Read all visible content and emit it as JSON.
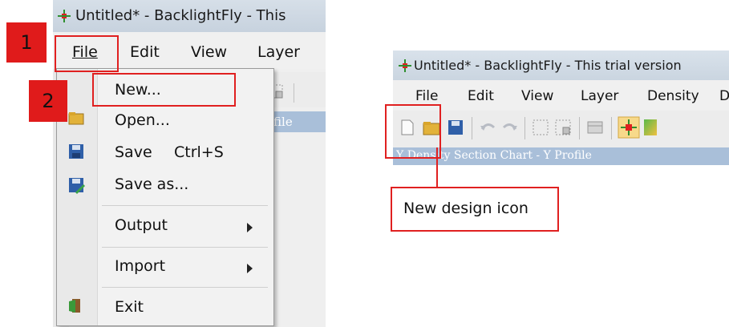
{
  "left": {
    "window_title": "Untitled* - BacklightFly - This",
    "menu": [
      "File",
      "Edit",
      "View",
      "Layer"
    ],
    "profile_text": "ofile",
    "dropdown": [
      {
        "label": "New...",
        "shortcut": "",
        "submenu": false
      },
      {
        "label": "Open...",
        "shortcut": "",
        "submenu": false
      },
      {
        "label": "Save",
        "shortcut": "Ctrl+S",
        "submenu": false
      },
      {
        "label": "Save as...",
        "shortcut": "",
        "submenu": false
      },
      {
        "label": "Output",
        "shortcut": "",
        "submenu": true
      },
      {
        "label": "Import",
        "shortcut": "",
        "submenu": true
      },
      {
        "label": "Exit",
        "shortcut": "",
        "submenu": false
      }
    ],
    "step_labels": [
      "1",
      "2"
    ]
  },
  "right": {
    "window_title": "Untitled* - BacklightFly - This trial version",
    "menu": [
      "File",
      "Edit",
      "View",
      "Layer",
      "Density"
    ],
    "section_text": "Y Density Section Chart - Y Profile",
    "callout": "New design icon"
  },
  "colors": {
    "highlight": "#e02020",
    "section_bar": "#a9bfd9"
  }
}
